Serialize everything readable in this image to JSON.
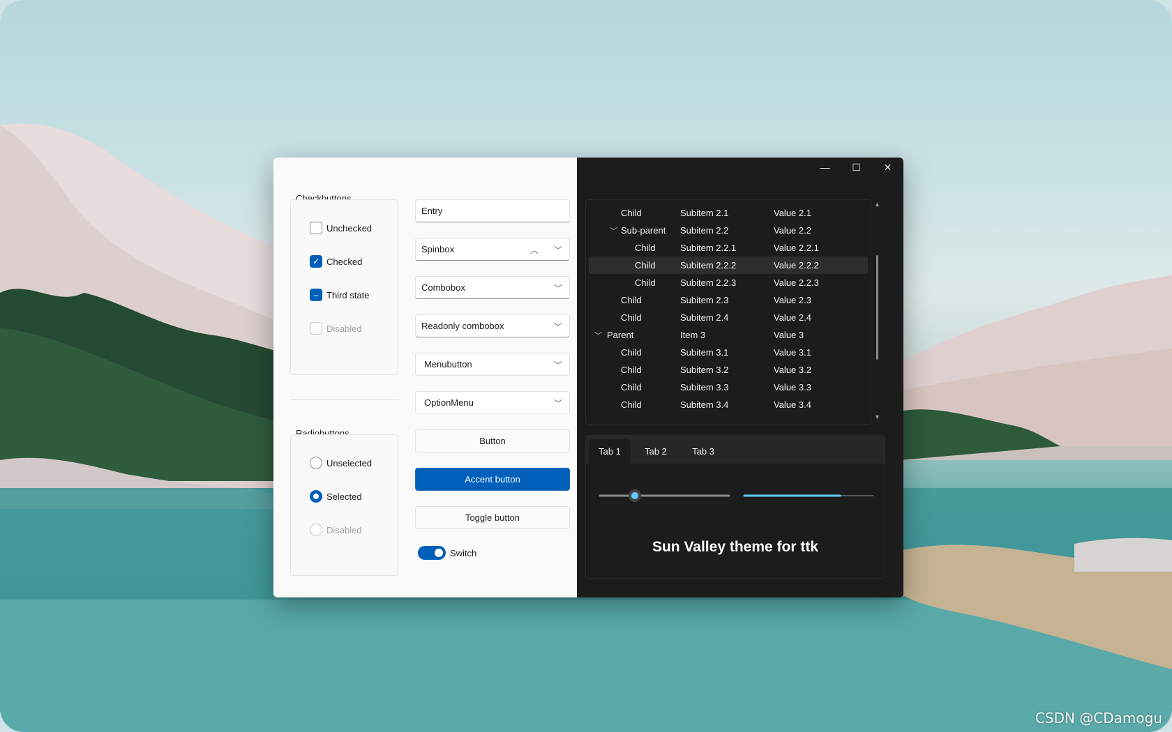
{
  "colors": {
    "accent": "#005fb8",
    "light_bg": "#fafafa",
    "dark_bg": "#1c1c1c"
  },
  "left_pane": {
    "checkbuttons": {
      "title": "Checkbuttons",
      "items": [
        {
          "label": "Unchecked",
          "state": "unchecked"
        },
        {
          "label": "Checked",
          "state": "checked"
        },
        {
          "label": "Third state",
          "state": "indeterminate"
        },
        {
          "label": "Disabled",
          "state": "disabled"
        }
      ]
    },
    "radiobuttons": {
      "title": "Radiobuttons",
      "items": [
        {
          "label": "Unselected",
          "state": "unselected"
        },
        {
          "label": "Selected",
          "state": "selected"
        },
        {
          "label": "Disabled",
          "state": "disabled"
        }
      ]
    },
    "widgets": {
      "entry_value": "Entry",
      "spinbox_value": "Spinbox",
      "combobox_value": "Combobox",
      "readonly_combobox_value": "Readonly combobox",
      "menubutton_label": "Menubutton",
      "optionmenu_label": "OptionMenu",
      "button_label": "Button",
      "accent_button_label": "Accent button",
      "toggle_button_label": "Toggle button",
      "switch_label": "Switch"
    }
  },
  "window_controls": {
    "minimize": "—",
    "maximize": "☐",
    "close": "✕"
  },
  "tree": {
    "rows": [
      {
        "c1": "Child",
        "c2": "Subitem 2.1",
        "c3": "Value 2.1"
      },
      {
        "c1": "Sub-parent",
        "c2": "Subitem 2.2",
        "c3": "Value 2.2"
      },
      {
        "c1": "Child",
        "c2": "Subitem 2.2.1",
        "c3": "Value 2.2.1"
      },
      {
        "c1": "Child",
        "c2": "Subitem 2.2.2",
        "c3": "Value 2.2.2"
      },
      {
        "c1": "Child",
        "c2": "Subitem 2.2.3",
        "c3": "Value 2.2.3"
      },
      {
        "c1": "Child",
        "c2": "Subitem 2.3",
        "c3": "Value 2.3"
      },
      {
        "c1": "Child",
        "c2": "Subitem 2.4",
        "c3": "Value 2.4"
      },
      {
        "c1": "Parent",
        "c2": "Item 3",
        "c3": "Value 3"
      },
      {
        "c1": "Child",
        "c2": "Subitem 3.1",
        "c3": "Value 3.1"
      },
      {
        "c1": "Child",
        "c2": "Subitem 3.2",
        "c3": "Value 3.2"
      },
      {
        "c1": "Child",
        "c2": "Subitem 3.3",
        "c3": "Value 3.3"
      },
      {
        "c1": "Child",
        "c2": "Subitem 3.4",
        "c3": "Value 3.4"
      }
    ],
    "selected_row": "Subitem 2.2.2"
  },
  "notebook": {
    "tabs": [
      "Tab 1",
      "Tab 2",
      "Tab 3"
    ],
    "active_tab": "Tab 1",
    "scale_fraction": 0.27,
    "progress_fraction": 0.74,
    "headline": "Sun Valley theme for ttk"
  },
  "watermark": "CSDN @CDamogu"
}
